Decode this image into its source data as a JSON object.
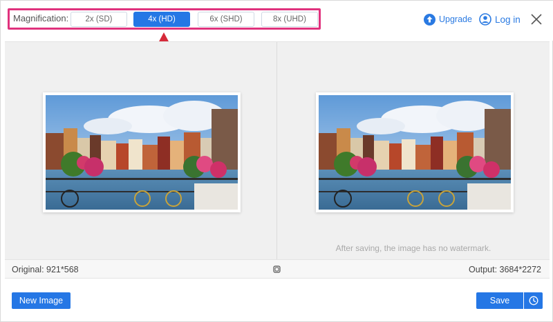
{
  "toolbar": {
    "magnification_label": "Magnification:",
    "options": [
      "2x (SD)",
      "4x (HD)",
      "6x (SHD)",
      "8x (UHD)"
    ],
    "selected": "4x (HD)",
    "upgrade_label": "Upgrade",
    "login_label": "Log in"
  },
  "preview": {
    "watermark_note": "After saving, the image has no watermark."
  },
  "info_bar": {
    "original": "Original: 921*568",
    "output": "Output: 3684*2272"
  },
  "footer": {
    "new_image_label": "New Image",
    "save_label": "Save"
  },
  "colors": {
    "accent": "#2577e5",
    "highlight_box": "#e0327d",
    "annotation_arrow": "#d62a3a"
  }
}
